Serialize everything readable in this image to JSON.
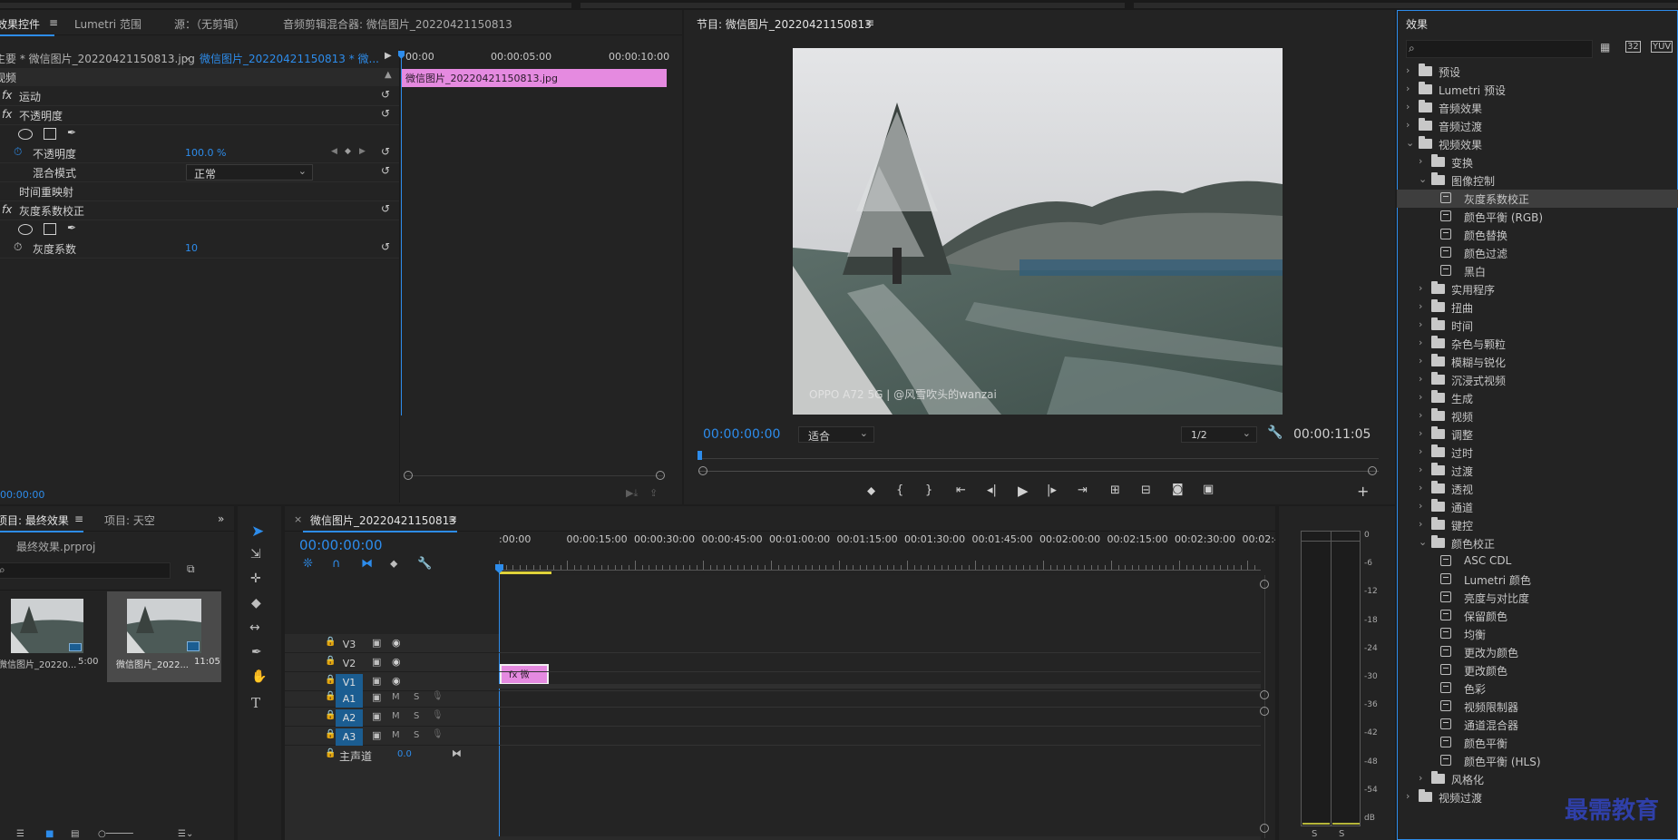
{
  "effect_controls": {
    "tabs": [
      "效果控件",
      "Lumetri 范围",
      "源：（无剪辑）",
      "音频剪辑混合器: 微信图片_20220421150813"
    ],
    "source_clip": "主要 * 微信图片_20220421150813.jpg",
    "sequence_clip": "微信图片_20220421150813 * 微...",
    "section_label": "视频",
    "ruler": [
      "00:00",
      "00:00:05:00",
      "00:00:10:00"
    ],
    "clip_bar": "微信图片_20220421150813.jpg",
    "rows": {
      "motion": "运动",
      "opacity": "不透明度",
      "opacity_param": "不透明度",
      "opacity_value": "100.0 %",
      "blend_mode": "混合模式",
      "blend_value": "正常",
      "time_remap": "时间重映射",
      "gamma_correction": "灰度系数校正",
      "gamma_param": "灰度系数",
      "gamma_value": "10"
    },
    "timecode": "00:00:00"
  },
  "program_monitor": {
    "title": "节目: 微信图片_20220421150813",
    "timecode": "00:00:00:00",
    "fit": "适合",
    "resolution": "1/2",
    "duration": "00:00:11:05",
    "watermark": "OPPO A72 5G | @风雪吹头的wanzai"
  },
  "project": {
    "tabs": [
      "项目: 最终效果",
      "项目: 天空"
    ],
    "file": "最终效果.prproj",
    "items": [
      {
        "name": "微信图片_20220...",
        "duration": "5:00"
      },
      {
        "name": "微信图片_2022...",
        "duration": "11:05"
      }
    ]
  },
  "timeline": {
    "title": "微信图片_20220421150813",
    "timecode": "00:00:00:00",
    "ruler": [
      ":00:00",
      "00:00:15:00",
      "00:00:30:00",
      "00:00:45:00",
      "00:01:00:00",
      "00:01:15:00",
      "00:01:30:00",
      "00:01:45:00",
      "00:02:00:00",
      "00:02:15:00",
      "00:02:30:00",
      "00:02:45:"
    ],
    "video_tracks": [
      "V3",
      "V2",
      "V1"
    ],
    "audio_tracks": [
      "A1",
      "A2",
      "A3"
    ],
    "master": "主声道",
    "master_value": "0.0",
    "clip_label": "fx 微"
  },
  "meter": {
    "scale": [
      "0",
      "-6",
      "-12",
      "-18",
      "-24",
      "-30",
      "-36",
      "-42",
      "-48",
      "-54",
      "dB"
    ],
    "channels": [
      "S",
      "S"
    ]
  },
  "effects": {
    "title": "效果",
    "tree": [
      {
        "label": "预设",
        "type": "folder",
        "level": 0,
        "open": false
      },
      {
        "label": "Lumetri 预设",
        "type": "folder",
        "level": 0,
        "open": false
      },
      {
        "label": "音频效果",
        "type": "folder",
        "level": 0,
        "open": false
      },
      {
        "label": "音频过渡",
        "type": "folder",
        "level": 0,
        "open": false
      },
      {
        "label": "视频效果",
        "type": "folder",
        "level": 0,
        "open": true
      },
      {
        "label": "变换",
        "type": "folder",
        "level": 1,
        "open": false
      },
      {
        "label": "图像控制",
        "type": "folder",
        "level": 1,
        "open": true
      },
      {
        "label": "灰度系数校正",
        "type": "fx",
        "level": 2,
        "selected": true
      },
      {
        "label": "颜色平衡 (RGB)",
        "type": "fx",
        "level": 2
      },
      {
        "label": "颜色替换",
        "type": "fx",
        "level": 2
      },
      {
        "label": "颜色过滤",
        "type": "fx",
        "level": 2
      },
      {
        "label": "黑白",
        "type": "fx",
        "level": 2
      },
      {
        "label": "实用程序",
        "type": "folder",
        "level": 1,
        "open": false
      },
      {
        "label": "扭曲",
        "type": "folder",
        "level": 1,
        "open": false
      },
      {
        "label": "时间",
        "type": "folder",
        "level": 1,
        "open": false
      },
      {
        "label": "杂色与颗粒",
        "type": "folder",
        "level": 1,
        "open": false
      },
      {
        "label": "模糊与锐化",
        "type": "folder",
        "level": 1,
        "open": false
      },
      {
        "label": "沉浸式视频",
        "type": "folder",
        "level": 1,
        "open": false
      },
      {
        "label": "生成",
        "type": "folder",
        "level": 1,
        "open": false
      },
      {
        "label": "视频",
        "type": "folder",
        "level": 1,
        "open": false
      },
      {
        "label": "调整",
        "type": "folder",
        "level": 1,
        "open": false
      },
      {
        "label": "过时",
        "type": "folder",
        "level": 1,
        "open": false
      },
      {
        "label": "过渡",
        "type": "folder",
        "level": 1,
        "open": false
      },
      {
        "label": "透视",
        "type": "folder",
        "level": 1,
        "open": false
      },
      {
        "label": "通道",
        "type": "folder",
        "level": 1,
        "open": false
      },
      {
        "label": "键控",
        "type": "folder",
        "level": 1,
        "open": false
      },
      {
        "label": "颜色校正",
        "type": "folder",
        "level": 1,
        "open": true
      },
      {
        "label": "ASC CDL",
        "type": "fx",
        "level": 2
      },
      {
        "label": "Lumetri 颜色",
        "type": "fx",
        "level": 2
      },
      {
        "label": "亮度与对比度",
        "type": "fx",
        "level": 2
      },
      {
        "label": "保留颜色",
        "type": "fx",
        "level": 2
      },
      {
        "label": "均衡",
        "type": "fx",
        "level": 2
      },
      {
        "label": "更改为颜色",
        "type": "fx",
        "level": 2
      },
      {
        "label": "更改颜色",
        "type": "fx",
        "level": 2
      },
      {
        "label": "色彩",
        "type": "fx",
        "level": 2
      },
      {
        "label": "视频限制器",
        "type": "fx",
        "level": 2
      },
      {
        "label": "通道混合器",
        "type": "fx",
        "level": 2
      },
      {
        "label": "颜色平衡",
        "type": "fx",
        "level": 2
      },
      {
        "label": "颜色平衡 (HLS)",
        "type": "fx",
        "level": 2
      },
      {
        "label": "风格化",
        "type": "folder",
        "level": 1,
        "open": false
      },
      {
        "label": "视频过渡",
        "type": "folder",
        "level": 0,
        "open": false
      }
    ]
  },
  "brand": "最需教育"
}
